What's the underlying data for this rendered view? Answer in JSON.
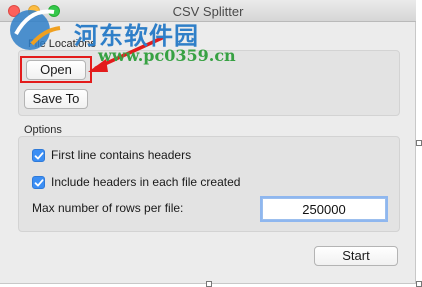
{
  "window": {
    "title": "CSV Splitter"
  },
  "file_locations": {
    "group_label": "File Locations",
    "open_label": "Open",
    "save_to_label": "Save To"
  },
  "options": {
    "group_label": "Options",
    "first_line_headers": {
      "label": "First line contains headers",
      "checked": true
    },
    "include_headers": {
      "label": "Include headers in each file created",
      "checked": true
    },
    "max_rows": {
      "label": "Max number of rows per file:",
      "value": "250000"
    }
  },
  "start_label": "Start",
  "watermark": {
    "text": "河东软件园",
    "url": "www.pc0359.cn"
  },
  "colors": {
    "accent": "#3b8ef4",
    "annotation": "#e31b1b"
  }
}
